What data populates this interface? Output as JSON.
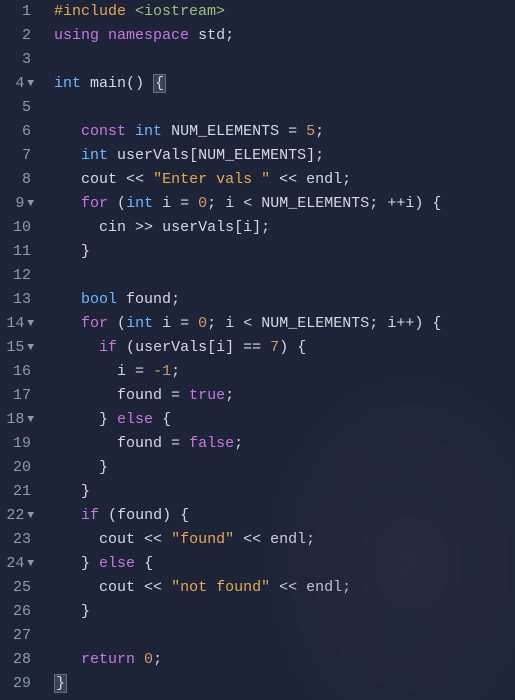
{
  "lines": [
    {
      "num": "1",
      "fold": ""
    },
    {
      "num": "2",
      "fold": ""
    },
    {
      "num": "3",
      "fold": ""
    },
    {
      "num": "4",
      "fold": "▼"
    },
    {
      "num": "5",
      "fold": ""
    },
    {
      "num": "6",
      "fold": ""
    },
    {
      "num": "7",
      "fold": ""
    },
    {
      "num": "8",
      "fold": ""
    },
    {
      "num": "9",
      "fold": "▼"
    },
    {
      "num": "10",
      "fold": ""
    },
    {
      "num": "11",
      "fold": ""
    },
    {
      "num": "12",
      "fold": ""
    },
    {
      "num": "13",
      "fold": ""
    },
    {
      "num": "14",
      "fold": "▼"
    },
    {
      "num": "15",
      "fold": "▼"
    },
    {
      "num": "16",
      "fold": ""
    },
    {
      "num": "17",
      "fold": ""
    },
    {
      "num": "18",
      "fold": "▼"
    },
    {
      "num": "19",
      "fold": ""
    },
    {
      "num": "20",
      "fold": ""
    },
    {
      "num": "21",
      "fold": ""
    },
    {
      "num": "22",
      "fold": "▼"
    },
    {
      "num": "23",
      "fold": ""
    },
    {
      "num": "24",
      "fold": "▼"
    },
    {
      "num": "25",
      "fold": ""
    },
    {
      "num": "26",
      "fold": ""
    },
    {
      "num": "27",
      "fold": ""
    },
    {
      "num": "28",
      "fold": ""
    },
    {
      "num": "29",
      "fold": ""
    }
  ],
  "tok": {
    "include": "#include",
    "iostream": "<iostream>",
    "using": "using",
    "namespace": "namespace",
    "std": "std",
    "semi": ";",
    "int": "int",
    "main": "main",
    "lparen": "(",
    "rparen": ")",
    "lbrace": "{",
    "rbrace": "}",
    "const": "const",
    "NUMEL": "NUM_ELEMENTS",
    "eq": "=",
    "five": "5",
    "userVals": "userVals",
    "lbr": "[",
    "rbr": "]",
    "cout": "cout",
    "ins": "<<",
    "entervals": "\"Enter vals \"",
    "endl": "endl",
    "for": "for",
    "i": "i",
    "zero": "0",
    "lt": "<",
    "ppi": "++i",
    "ipp": "i++",
    "cin": "cin",
    "ext": ">>",
    "bool": "bool",
    "found": "found",
    "if": "if",
    "eqeq": "==",
    "seven": "7",
    "neg1": "-1",
    "true": "true",
    "else": "else",
    "false": "false",
    "foundstr": "\"found\"",
    "notfoundstr": "\"not found\"",
    "return": "return"
  }
}
